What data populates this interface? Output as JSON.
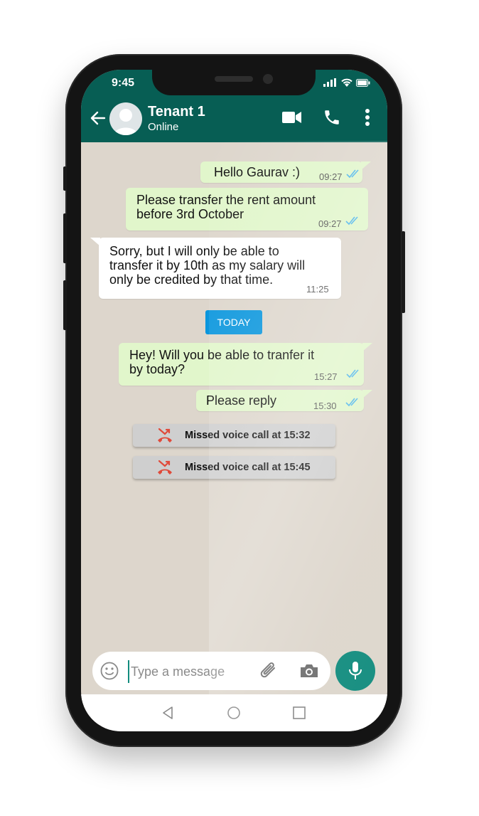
{
  "status_bar": {
    "time": "9:45"
  },
  "header": {
    "contact_name": "Tenant 1",
    "contact_status": "Online",
    "icons": [
      "back-arrow-icon",
      "avatar",
      "video-call-icon",
      "phone-call-icon",
      "more-options-icon"
    ]
  },
  "messages": [
    {
      "direction": "out",
      "text": "Hello Gaurav :)",
      "time": "09:27",
      "ticks": "read"
    },
    {
      "direction": "out",
      "text_lines": [
        "Please transfer the rent amount",
        "before 3rd October"
      ],
      "time": "09:27",
      "ticks": "read"
    },
    {
      "direction": "in",
      "text_lines": [
        "Sorry, but I will only be able to",
        "transfer it by 10th as my salary will",
        "only be credited by that time."
      ],
      "time": "11:25"
    },
    {
      "direction": "out",
      "text_lines": [
        "Hey! Will you be able to tranfer it",
        "by today?"
      ],
      "time": "15:27",
      "ticks": "read"
    },
    {
      "direction": "out",
      "text": "Please reply",
      "time": "15:30",
      "ticks": "read"
    }
  ],
  "date_divider": "TODAY",
  "missed_calls": [
    {
      "label": "Missed voice call at 15:32"
    },
    {
      "label": "Missed voice call at 15:45"
    }
  ],
  "composer": {
    "placeholder": "Type a message",
    "icons": [
      "emoji-icon",
      "attach-icon",
      "camera-icon",
      "mic-icon"
    ]
  },
  "colors": {
    "header": "#075e54",
    "outgoing_bubble": "#e1f6cb",
    "incoming_bubble": "#ffffff",
    "chat_bg": "#ddd6cc",
    "accent": "#128c7e",
    "today_badge": "#0a96dd",
    "read_ticks": "#4fb6ec",
    "missed_call": "#e04a3a"
  }
}
